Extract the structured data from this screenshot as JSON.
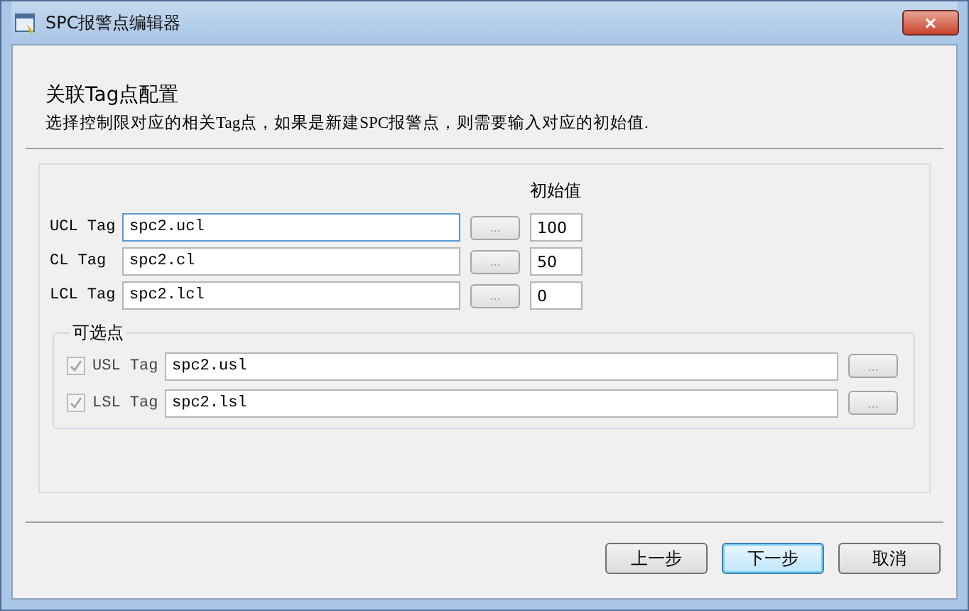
{
  "window": {
    "title": "SPC报警点编辑器",
    "close": "×"
  },
  "heading": "关联Tag点配置",
  "description": "选择控制限对应的相关Tag点，如果是新建SPC报警点，则需要输入对应的初始值.",
  "initial_header": "初始值",
  "tags": [
    {
      "label": "UCL Tag",
      "value": "spc2.ucl",
      "browse": "...",
      "initial": "100",
      "focused": true
    },
    {
      "label": "CL Tag",
      "value": "spc2.cl",
      "browse": "...",
      "initial": "50",
      "focused": false
    },
    {
      "label": "LCL Tag",
      "value": "spc2.lcl",
      "browse": "...",
      "initial": "0",
      "focused": false
    }
  ],
  "optional": {
    "legend": "可选点",
    "items": [
      {
        "label": "USL Tag",
        "value": "spc2.usl",
        "browse": "...",
        "checked": true,
        "disabled": true
      },
      {
        "label": "LSL Tag",
        "value": "spc2.lsl",
        "browse": "...",
        "checked": true,
        "disabled": true
      }
    ]
  },
  "buttons": [
    {
      "label": "上一步",
      "default": false
    },
    {
      "label": "下一步",
      "default": true
    },
    {
      "label": "取消",
      "default": false
    }
  ]
}
